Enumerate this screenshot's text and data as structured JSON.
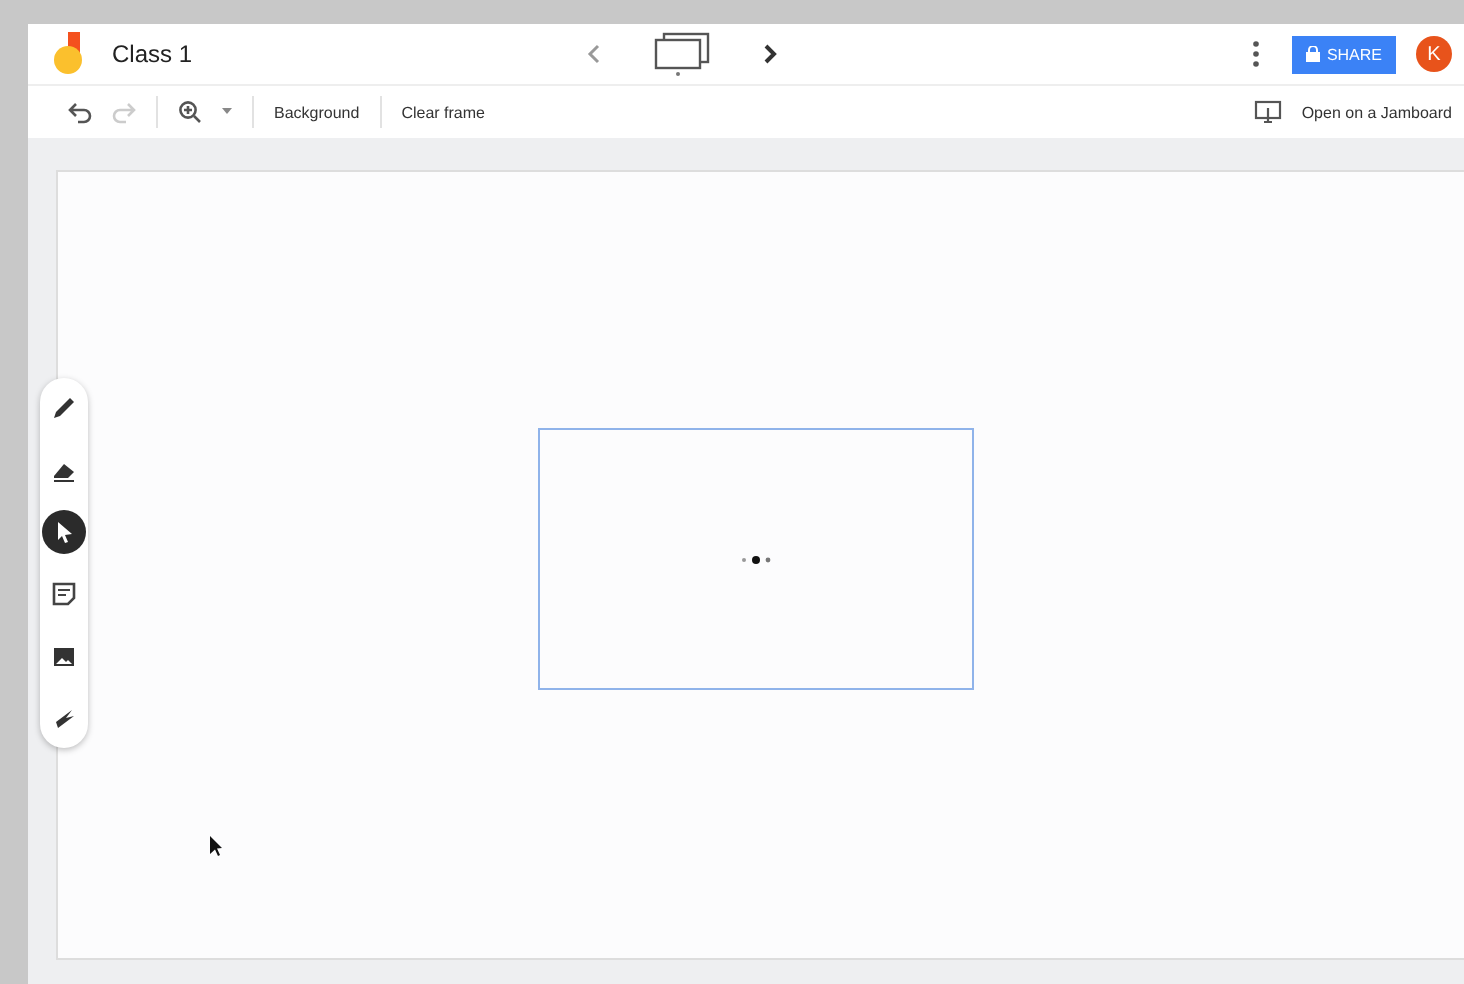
{
  "header": {
    "title": "Class 1",
    "share": "SHARE",
    "avatar": "K"
  },
  "toolbar": {
    "background": "Background",
    "clear": "Clear frame",
    "open": "Open on a Jamboard"
  },
  "tools": [
    {
      "kind": "pen",
      "selected": false
    },
    {
      "kind": "eraser",
      "selected": false
    },
    {
      "kind": "select",
      "selected": true
    },
    {
      "kind": "note",
      "selected": false
    },
    {
      "kind": "image",
      "selected": false
    },
    {
      "kind": "laser",
      "selected": false
    }
  ]
}
